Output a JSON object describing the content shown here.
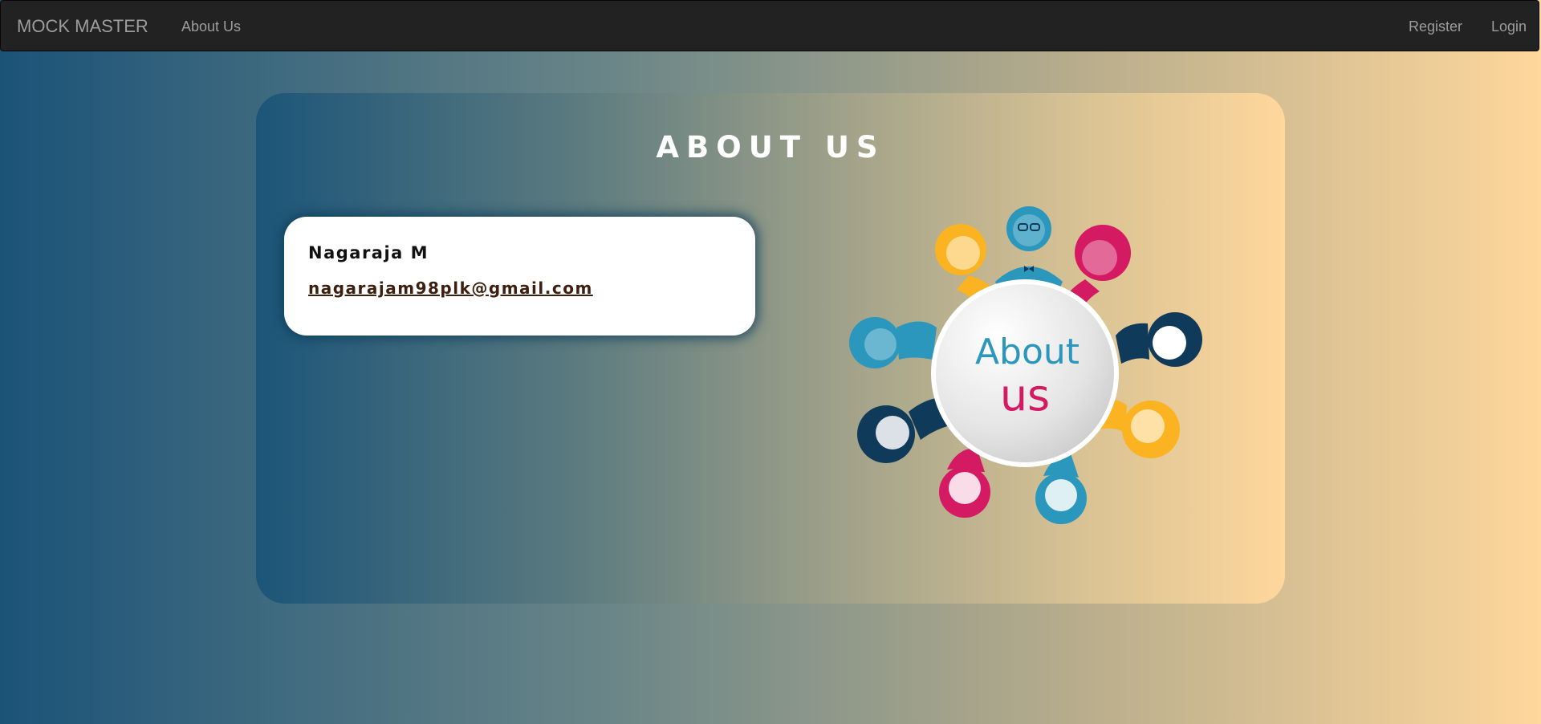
{
  "navbar": {
    "brand": "MOCK MASTER",
    "about_link": "About Us",
    "register_link": "Register",
    "login_link": "Login"
  },
  "panel": {
    "title": "ABOUT US",
    "card": {
      "name": "Nagaraja M",
      "email": "nagarajam98plk@gmail.com"
    },
    "illustration": {
      "line1": "About",
      "line2": "us",
      "colors": {
        "blue": "#2b97bd",
        "navy": "#0f3a5a",
        "magenta": "#d41a62",
        "yellow": "#fbb321"
      }
    }
  },
  "colors": {
    "navbar_bg": "#222222",
    "nav_text": "#9d9d9d",
    "gradient_start": "#1b5378",
    "gradient_end": "#fed79c"
  }
}
